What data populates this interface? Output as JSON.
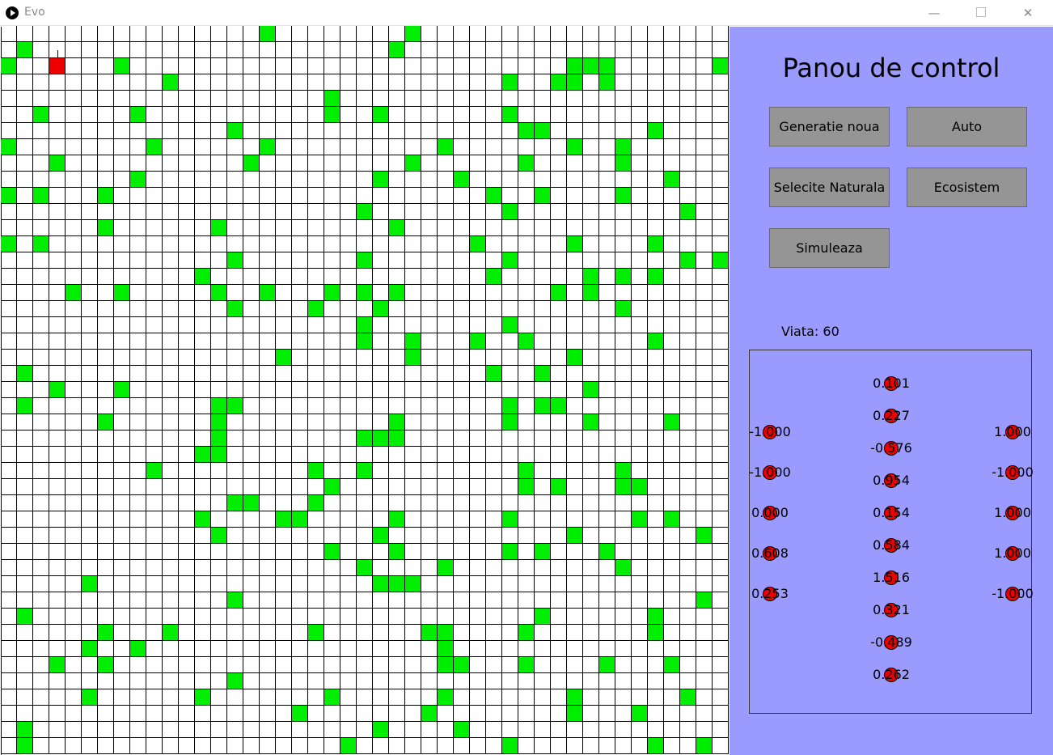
{
  "window": {
    "title": "Evo"
  },
  "grid": {
    "cols": 45,
    "rows": 45,
    "food": [
      [
        16,
        0
      ],
      [
        25,
        0
      ],
      [
        1,
        1
      ],
      [
        24,
        1
      ],
      [
        0,
        2
      ],
      [
        7,
        2
      ],
      [
        35,
        2
      ],
      [
        36,
        2
      ],
      [
        37,
        2
      ],
      [
        44,
        2
      ],
      [
        10,
        3
      ],
      [
        31,
        3
      ],
      [
        34,
        3
      ],
      [
        35,
        3
      ],
      [
        37,
        3
      ],
      [
        20,
        4
      ],
      [
        2,
        5
      ],
      [
        8,
        5
      ],
      [
        20,
        5
      ],
      [
        23,
        5
      ],
      [
        31,
        5
      ],
      [
        14,
        6
      ],
      [
        32,
        6
      ],
      [
        33,
        6
      ],
      [
        40,
        6
      ],
      [
        0,
        7
      ],
      [
        9,
        7
      ],
      [
        16,
        7
      ],
      [
        27,
        7
      ],
      [
        35,
        7
      ],
      [
        38,
        7
      ],
      [
        3,
        8
      ],
      [
        15,
        8
      ],
      [
        25,
        8
      ],
      [
        32,
        8
      ],
      [
        38,
        8
      ],
      [
        8,
        9
      ],
      [
        23,
        9
      ],
      [
        28,
        9
      ],
      [
        41,
        9
      ],
      [
        0,
        10
      ],
      [
        2,
        10
      ],
      [
        6,
        10
      ],
      [
        30,
        10
      ],
      [
        33,
        10
      ],
      [
        38,
        10
      ],
      [
        22,
        11
      ],
      [
        31,
        11
      ],
      [
        42,
        11
      ],
      [
        6,
        12
      ],
      [
        13,
        12
      ],
      [
        24,
        12
      ],
      [
        0,
        13
      ],
      [
        2,
        13
      ],
      [
        29,
        13
      ],
      [
        35,
        13
      ],
      [
        40,
        13
      ],
      [
        14,
        14
      ],
      [
        22,
        14
      ],
      [
        31,
        14
      ],
      [
        42,
        14
      ],
      [
        44,
        14
      ],
      [
        12,
        15
      ],
      [
        30,
        15
      ],
      [
        36,
        15
      ],
      [
        38,
        15
      ],
      [
        40,
        15
      ],
      [
        4,
        16
      ],
      [
        7,
        16
      ],
      [
        13,
        16
      ],
      [
        16,
        16
      ],
      [
        20,
        16
      ],
      [
        22,
        16
      ],
      [
        24,
        16
      ],
      [
        34,
        16
      ],
      [
        36,
        16
      ],
      [
        14,
        17
      ],
      [
        19,
        17
      ],
      [
        23,
        17
      ],
      [
        38,
        17
      ],
      [
        22,
        18
      ],
      [
        31,
        18
      ],
      [
        22,
        19
      ],
      [
        25,
        19
      ],
      [
        29,
        19
      ],
      [
        32,
        19
      ],
      [
        40,
        19
      ],
      [
        17,
        20
      ],
      [
        25,
        20
      ],
      [
        35,
        20
      ],
      [
        1,
        21
      ],
      [
        30,
        21
      ],
      [
        33,
        21
      ],
      [
        3,
        22
      ],
      [
        7,
        22
      ],
      [
        36,
        22
      ],
      [
        1,
        23
      ],
      [
        13,
        23
      ],
      [
        14,
        23
      ],
      [
        31,
        23
      ],
      [
        33,
        23
      ],
      [
        34,
        23
      ],
      [
        6,
        24
      ],
      [
        13,
        24
      ],
      [
        24,
        24
      ],
      [
        31,
        24
      ],
      [
        36,
        24
      ],
      [
        41,
        24
      ],
      [
        13,
        25
      ],
      [
        22,
        25
      ],
      [
        23,
        25
      ],
      [
        24,
        25
      ],
      [
        12,
        26
      ],
      [
        13,
        26
      ],
      [
        9,
        27
      ],
      [
        19,
        27
      ],
      [
        22,
        27
      ],
      [
        32,
        27
      ],
      [
        38,
        27
      ],
      [
        20,
        28
      ],
      [
        32,
        28
      ],
      [
        34,
        28
      ],
      [
        38,
        28
      ],
      [
        39,
        28
      ],
      [
        14,
        29
      ],
      [
        15,
        29
      ],
      [
        19,
        29
      ],
      [
        12,
        30
      ],
      [
        17,
        30
      ],
      [
        18,
        30
      ],
      [
        24,
        30
      ],
      [
        31,
        30
      ],
      [
        39,
        30
      ],
      [
        41,
        30
      ],
      [
        13,
        31
      ],
      [
        23,
        31
      ],
      [
        35,
        31
      ],
      [
        43,
        31
      ],
      [
        20,
        32
      ],
      [
        24,
        32
      ],
      [
        31,
        32
      ],
      [
        33,
        32
      ],
      [
        37,
        32
      ],
      [
        22,
        33
      ],
      [
        27,
        33
      ],
      [
        38,
        33
      ],
      [
        5,
        34
      ],
      [
        23,
        34
      ],
      [
        24,
        34
      ],
      [
        25,
        34
      ],
      [
        14,
        35
      ],
      [
        43,
        35
      ],
      [
        1,
        36
      ],
      [
        33,
        36
      ],
      [
        40,
        36
      ],
      [
        6,
        37
      ],
      [
        10,
        37
      ],
      [
        19,
        37
      ],
      [
        26,
        37
      ],
      [
        27,
        37
      ],
      [
        32,
        37
      ],
      [
        40,
        37
      ],
      [
        5,
        38
      ],
      [
        8,
        38
      ],
      [
        27,
        38
      ],
      [
        3,
        39
      ],
      [
        6,
        39
      ],
      [
        27,
        39
      ],
      [
        28,
        39
      ],
      [
        32,
        39
      ],
      [
        37,
        39
      ],
      [
        41,
        39
      ],
      [
        14,
        40
      ],
      [
        5,
        41
      ],
      [
        12,
        41
      ],
      [
        20,
        41
      ],
      [
        27,
        41
      ],
      [
        35,
        41
      ],
      [
        42,
        41
      ],
      [
        18,
        42
      ],
      [
        26,
        42
      ],
      [
        35,
        42
      ],
      [
        39,
        42
      ],
      [
        1,
        43
      ],
      [
        23,
        43
      ],
      [
        28,
        43
      ],
      [
        1,
        44
      ],
      [
        21,
        44
      ],
      [
        31,
        44
      ],
      [
        40,
        44
      ],
      [
        43,
        44
      ]
    ],
    "agent": {
      "col": 3,
      "row": 2,
      "direction": "up"
    }
  },
  "panel": {
    "title": "Panou de control",
    "buttons": {
      "new_generation": "Generatie noua",
      "auto": "Auto",
      "natural_selection": "Selecite Naturala",
      "ecosystem": "Ecosistem",
      "simulate": "Simuleaza"
    },
    "life_label": "Viata: 60",
    "network": {
      "inputs": [
        "-1.000",
        "-1.000",
        "0.000",
        "0.608",
        "0.253"
      ],
      "hidden": [
        "0.101",
        "0.227",
        "-0.576",
        "0.954",
        "0.154",
        "0.584",
        "1.516",
        "0.321",
        "-0.489",
        "0.262"
      ],
      "outputs": [
        "1.000",
        "-1.000",
        "1.000",
        "1.000",
        "-1.000"
      ]
    }
  },
  "colors": {
    "food": "#00ee00",
    "agent": "#ee0000",
    "panel_bg": "#9a9aff",
    "button_bg": "#959595"
  }
}
